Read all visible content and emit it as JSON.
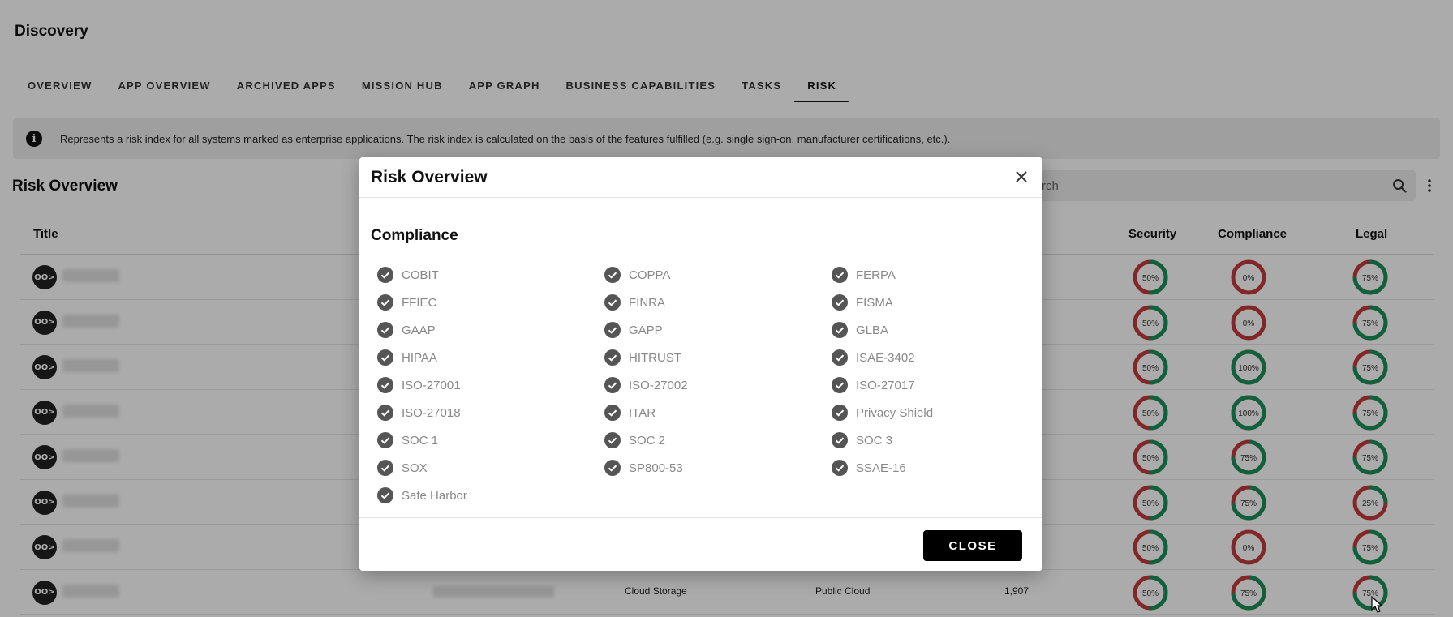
{
  "app": {
    "page_title": "Discovery",
    "tabs": [
      {
        "label": "OVERVIEW",
        "active": false
      },
      {
        "label": "APP OVERVIEW",
        "active": false
      },
      {
        "label": "ARCHIVED APPS",
        "active": false
      },
      {
        "label": "MISSION HUB",
        "active": false
      },
      {
        "label": "APP GRAPH",
        "active": false
      },
      {
        "label": "BUSINESS CAPABILITIES",
        "active": false
      },
      {
        "label": "TASKS",
        "active": false
      },
      {
        "label": "RISK",
        "active": true
      }
    ],
    "info_icon": "info-icon",
    "info_text": "Represents a risk index for all systems marked as enterprise applications. The risk index is calculated on the basis of the features fulfilled (e.g. single sign-on, manufacturer certifications, etc.).",
    "section_title": "Risk Overview",
    "search_placeholder": "rch",
    "table": {
      "headers": {
        "title": "Title",
        "security": "Security",
        "compliance": "Compliance",
        "legal": "Legal"
      },
      "avatar_text": "OO>",
      "rows": [
        {
          "security": 50,
          "compliance": 0,
          "legal": 75
        },
        {
          "security": 50,
          "compliance": 0,
          "legal": 75
        },
        {
          "security": 50,
          "compliance": 100,
          "legal": 75
        },
        {
          "security": 50,
          "compliance": 100,
          "legal": 75
        },
        {
          "security": 50,
          "compliance": 75,
          "legal": 75
        },
        {
          "security": 50,
          "compliance": 75,
          "legal": 25
        },
        {
          "security": 50,
          "compliance": 0,
          "legal": 75
        },
        {
          "security": 50,
          "compliance": 75,
          "legal": 75,
          "category": "Cloud Storage",
          "hosting": "Public Cloud",
          "count": "1,907"
        }
      ]
    }
  },
  "modal": {
    "title": "Risk Overview",
    "heading": "Compliance",
    "items": [
      "COBIT",
      "COPPA",
      "FERPA",
      "FFIEC",
      "FINRA",
      "FISMA",
      "GAAP",
      "GAPP",
      "GLBA",
      "HIPAA",
      "HITRUST",
      "ISAE-3402",
      "ISO-27001",
      "ISO-27002",
      "ISO-27017",
      "ISO-27018",
      "ITAR",
      "Privacy Shield",
      "SOC 1",
      "SOC 2",
      "SOC 3",
      "SOX",
      "SP800-53",
      "SSAE-16",
      "Safe Harbor"
    ],
    "close_label": "CLOSE"
  },
  "colors": {
    "ring_good": "#1a8f5c",
    "ring_bad": "#c23b3b",
    "check": "#555555"
  }
}
